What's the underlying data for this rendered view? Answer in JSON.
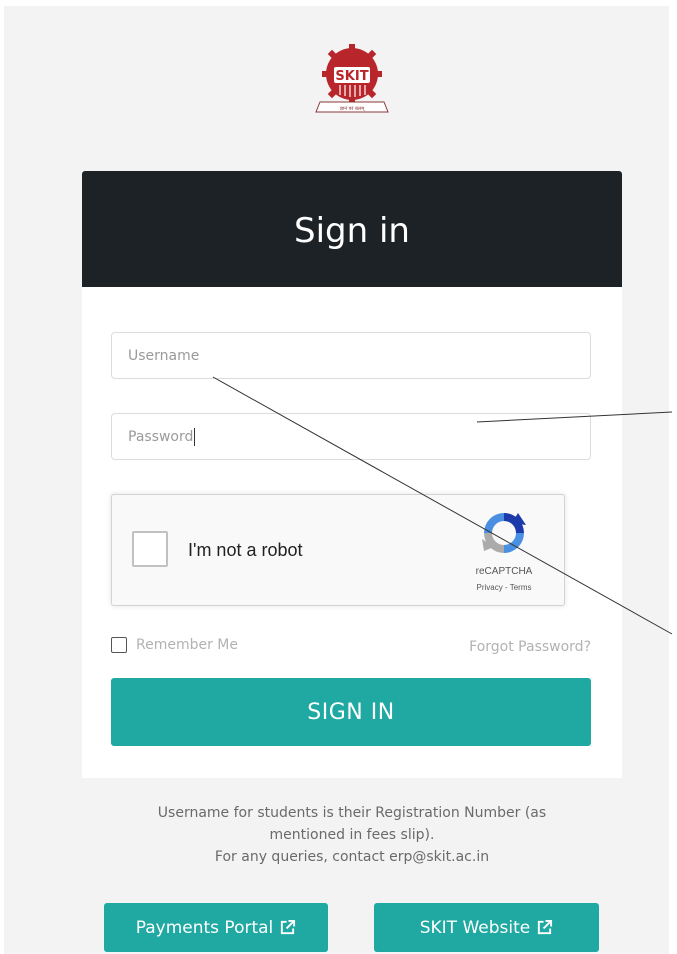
{
  "logo": {
    "text": "SKIT",
    "tagline": "ज्ञानं परं बलम्"
  },
  "header": {
    "title": "Sign in"
  },
  "form": {
    "username_placeholder": "Username",
    "password_placeholder": "Password",
    "recaptcha": {
      "label": "I'm not a robot",
      "brand": "reCAPTCHA",
      "links": "Privacy - Terms"
    },
    "remember_label": "Remember Me",
    "forgot_label": "Forgot Password?",
    "submit_label": "SIGN IN"
  },
  "help": {
    "line1": "Username for students is their Registration Number (as mentioned in fees slip).",
    "line2": "For any queries, contact erp@skit.ac.in"
  },
  "links": {
    "payments_label": "Payments Portal",
    "website_label": "SKIT Website"
  },
  "colors": {
    "header_bg": "#1c2225",
    "accent": "#1fa9a2",
    "logo_red": "#b8262b"
  },
  "icons": {
    "external_link": "external-link-icon",
    "recaptcha": "recaptcha-icon",
    "logo": "skit-logo"
  }
}
